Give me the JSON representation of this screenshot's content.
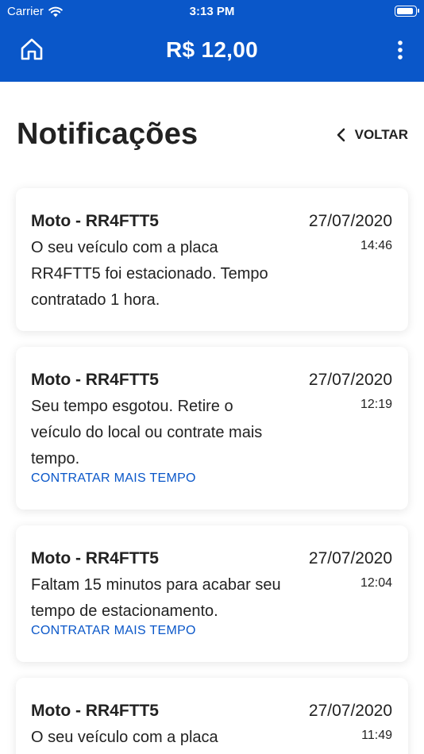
{
  "status_bar": {
    "carrier": "Carrier",
    "time": "3:13 PM",
    "battery_level": 0.95
  },
  "header": {
    "balance": "R$ 12,00",
    "icons": {
      "home": "home-icon",
      "menu": "more-vertical-icon"
    }
  },
  "page": {
    "title": "Notificações",
    "back_label": "VOLTAR"
  },
  "notifications": [
    {
      "vehicle": "Moto - RR4FTT5",
      "date": "27/07/2020",
      "time": "14:46",
      "message": "O seu veículo com a placa RR4FTT5 foi estacionado. Tempo contratado 1 hora.",
      "action": ""
    },
    {
      "vehicle": "Moto - RR4FTT5",
      "date": "27/07/2020",
      "time": "12:19",
      "message": "Seu tempo esgotou. Retire o veículo do local ou contrate mais tempo.",
      "action": "CONTRATAR MAIS TEMPO"
    },
    {
      "vehicle": "Moto - RR4FTT5",
      "date": "27/07/2020",
      "time": "12:04",
      "message": "Faltam 15 minutos para acabar seu tempo de estacionamento.",
      "action": "CONTRATAR MAIS TEMPO"
    },
    {
      "vehicle": "Moto - RR4FTT5",
      "date": "27/07/2020",
      "time": "11:49",
      "message": "O seu veículo com a placa",
      "action": ""
    }
  ],
  "colors": {
    "primary": "#0a57c9",
    "text": "#222222",
    "card_bg": "#ffffff"
  }
}
